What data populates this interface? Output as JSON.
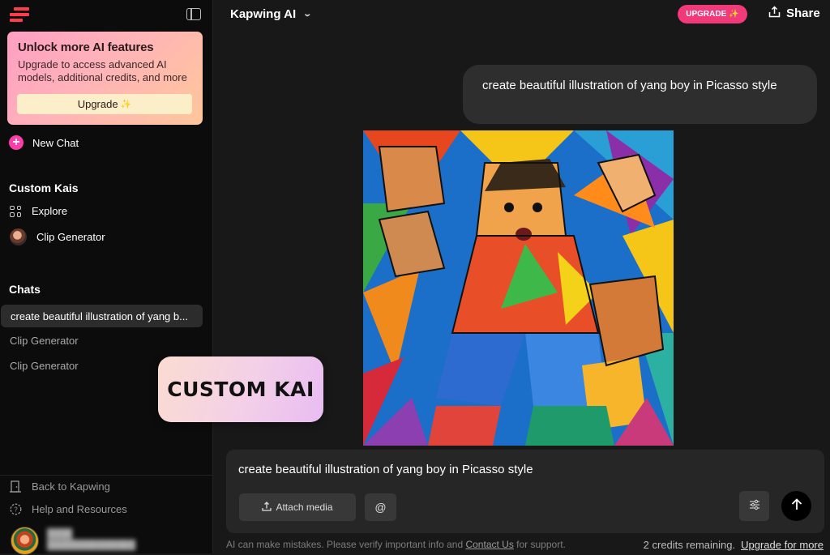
{
  "sidebar": {
    "upgrade_card": {
      "title": "Unlock more AI features",
      "description": "Upgrade to access advanced AI models, additional credits, and more",
      "button_label": "Upgrade",
      "button_sparkle": "✨"
    },
    "new_chat_label": "New Chat",
    "custom_kais": {
      "title": "Custom Kais",
      "items": [
        {
          "label": "Explore",
          "icon": "grid-icon"
        },
        {
          "label": "Clip Generator",
          "icon": "avatar"
        }
      ]
    },
    "chats": {
      "title": "Chats",
      "items": [
        {
          "label": "create beautiful illustration of yang b...",
          "active": true
        },
        {
          "label": "Clip Generator",
          "active": false
        },
        {
          "label": "Clip Generator",
          "active": false
        }
      ]
    },
    "footer": {
      "back_label": "Back to Kapwing",
      "help_label": "Help and Resources"
    }
  },
  "overlay": {
    "badge_text": "CUSTOM KAI"
  },
  "header": {
    "title": "Kapwing AI",
    "upgrade_label": "UPGRADE",
    "upgrade_sparkle": "✨",
    "share_label": "Share"
  },
  "chat": {
    "user_message": "create beautiful illustration of yang boy in Picasso style"
  },
  "composer": {
    "input_value": "create beautiful illustration of yang boy in Picasso style",
    "attach_label": "Attach media",
    "mention_label": "@"
  },
  "footer": {
    "disclaimer_prefix": "AI can make mistakes. Please verify important info and ",
    "disclaimer_link": "Contact Us",
    "disclaimer_suffix": " for support.",
    "credits_text": "2 credits remaining.",
    "credits_link": "Upgrade for more"
  },
  "colors": {
    "brand_red": "#ff3b4e",
    "upgrade_pink": "#f2397a",
    "new_chat_pink": "#ff3da8",
    "background": "#181818",
    "sidebar_bg": "#0c0c0c"
  }
}
